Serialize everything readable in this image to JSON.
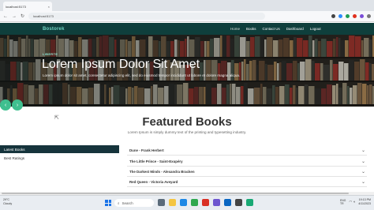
{
  "browser": {
    "tab_title": "localhost:5173",
    "url": "localhost:5173",
    "tab_close": "×",
    "back": "←",
    "forward": "→",
    "reload": "↻"
  },
  "nav": {
    "brand": "Bostorek",
    "links": [
      "Home",
      "Books",
      "Contact Us",
      "Dashboard",
      "Logout"
    ]
  },
  "hero": {
    "kicker": "LIBERTE",
    "title": "Lorem Ipsum Dolor Sit Amet",
    "description": "Lorem ipsum dolor sit amet, consectetur adipiscing elit, sed do eiusmod tempor incididunt ut labore et dolore magna aliqua.",
    "prev": "‹",
    "next": "›"
  },
  "featured": {
    "title": "Featured Books",
    "subtitle": "Lorem Ipsum is simply dummy text of the printing and typesetting industry."
  },
  "categories": [
    "Latest Books",
    "Best Ratings"
  ],
  "books": [
    "Dune - Frank Herbert",
    "The Little Prince - Saint-Exupéry",
    "The Darkest Minds - Alexandra Bracken",
    "Red Queen - Victoria Aveyard"
  ],
  "taskbar": {
    "weather_temp": "29°C",
    "weather_desc": "Cloudy",
    "search_label": "Search",
    "lang_line1": "ENG",
    "lang_line2": "TR",
    "time": "19:13 PM",
    "date": "4/11/2023"
  },
  "colors": {
    "nav_bg": "#0f3f3c",
    "accent": "#3fbf8f",
    "category_active_bg": "#16343c"
  }
}
